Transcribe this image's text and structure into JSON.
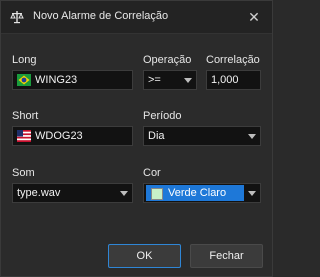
{
  "window": {
    "title": "Novo Alarme de Correlação",
    "close_glyph": "✕",
    "icon": "scale-icon"
  },
  "long": {
    "label": "Long",
    "value": "WING23",
    "flag": "brazil-flag-icon"
  },
  "operation": {
    "label": "Operação",
    "value": ">="
  },
  "correlation": {
    "label": "Correlação",
    "value": "1,000"
  },
  "short": {
    "label": "Short",
    "value": "WDOG23",
    "flag": "usa-flag-icon"
  },
  "period": {
    "label": "Período",
    "value": "Dia"
  },
  "sound": {
    "label": "Som",
    "value": "type.wav"
  },
  "color": {
    "label": "Cor",
    "value": "Verde Claro",
    "swatch": "#c8f0c8",
    "highlight": "#1e78d8"
  },
  "buttons": {
    "ok": "OK",
    "close": "Fechar"
  },
  "colors": {
    "accent": "#2f86d6",
    "background": "#2b2b2b",
    "field_background": "#121212"
  }
}
